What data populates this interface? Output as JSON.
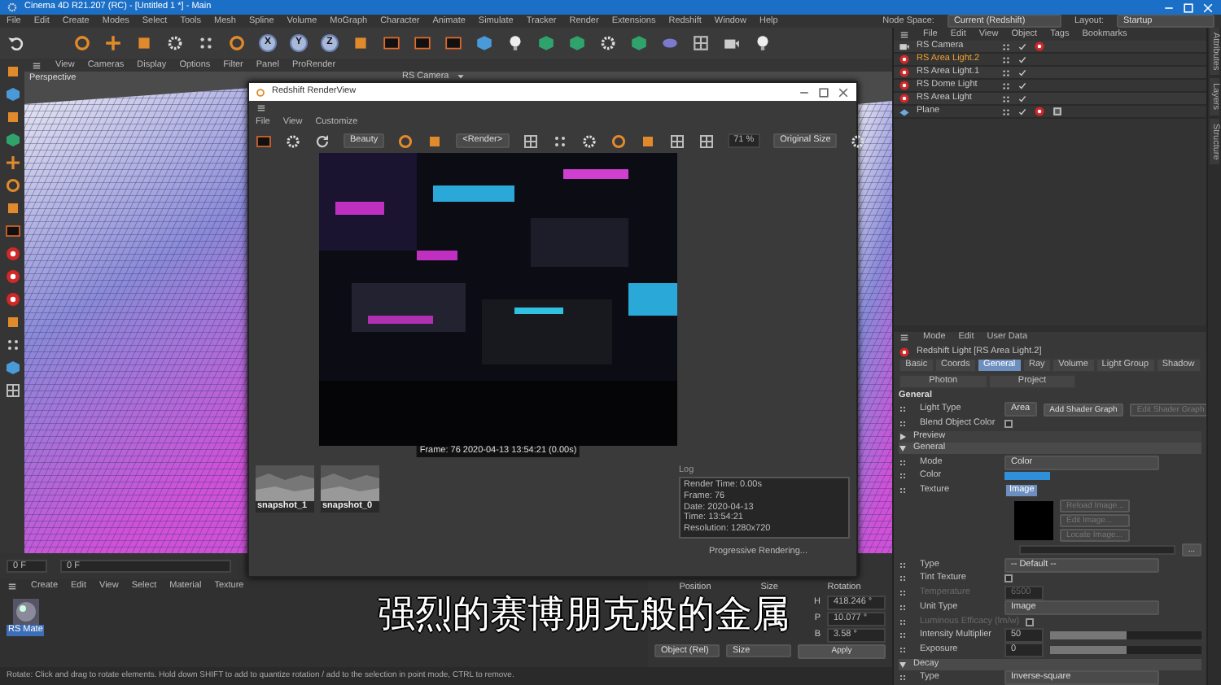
{
  "window": {
    "title": "Cinema 4D R21.207 (RC) - [Untitled 1 *] - Main"
  },
  "menu_bar": [
    "File",
    "Edit",
    "Create",
    "Modes",
    "Select",
    "Tools",
    "Mesh",
    "Spline",
    "Volume",
    "MoGraph",
    "Character",
    "Animate",
    "Simulate",
    "Tracker",
    "Render",
    "Extensions",
    "Redshift",
    "Window",
    "Help"
  ],
  "node_space": {
    "label": "Node Space:",
    "value": "Current (Redshift)"
  },
  "layout": {
    "label": "Layout:",
    "value": "Startup"
  },
  "axis_toggles": [
    {
      "label": "X",
      "on": true
    },
    {
      "label": "Y",
      "on": true
    },
    {
      "label": "Z",
      "on": true
    }
  ],
  "viewport": {
    "menu": [
      "View",
      "Cameras",
      "Display",
      "Options",
      "Filter",
      "Panel",
      "ProRender"
    ],
    "name": "Perspective",
    "camera": "RS Camera"
  },
  "render_view": {
    "title": "Redshift RenderView",
    "menu": [
      "File",
      "View",
      "Customize"
    ],
    "aov": "Beauty",
    "render": "<Render>",
    "zoom": "71 %",
    "size": "Original Size",
    "caption": "Frame: 76  2020-04-13  13:54:21  (0.00s)",
    "snapshots": [
      {
        "label": "snapshot_1"
      },
      {
        "label": "snapshot_0"
      }
    ],
    "log": {
      "title": "Log",
      "lines": [
        "Render Time: 0.00s",
        "Frame: 76",
        "Date: 2020-04-13",
        "Time: 13:54:21",
        "Resolution: 1280x720"
      ]
    },
    "progress": "Progressive Rendering..."
  },
  "object_manager": {
    "menu": [
      "File",
      "Edit",
      "View",
      "Object",
      "Tags",
      "Bookmarks"
    ],
    "objects": [
      {
        "name": "RS Camera",
        "kind": "camera",
        "selected": false
      },
      {
        "name": "RS Area Light.2",
        "kind": "light",
        "selected": true
      },
      {
        "name": "RS Area Light.1",
        "kind": "light",
        "selected": false
      },
      {
        "name": "RS Dome Light",
        "kind": "light",
        "selected": false
      },
      {
        "name": "RS Area Light",
        "kind": "light",
        "selected": false
      },
      {
        "name": "Plane",
        "kind": "plane",
        "selected": false
      }
    ]
  },
  "attributes": {
    "menu": [
      "Mode",
      "Edit",
      "User Data"
    ],
    "title": "Redshift Light [RS Area Light.2]",
    "tabs": [
      {
        "label": "Basic",
        "selected": false
      },
      {
        "label": "Coords",
        "selected": false
      },
      {
        "label": "General",
        "selected": true
      },
      {
        "label": "Ray",
        "selected": false
      },
      {
        "label": "Volume",
        "selected": false
      },
      {
        "label": "Light Group",
        "selected": false
      },
      {
        "label": "Shadow",
        "selected": false
      },
      {
        "label": "Photon",
        "selected": false
      },
      {
        "label": "Project",
        "selected": false
      }
    ],
    "heading": "General",
    "rows": [
      {
        "kind": "dropdown",
        "label": "Light Type",
        "value": "Area",
        "buttons": [
          {
            "label": "Add Shader Graph",
            "disabled": false
          },
          {
            "label": "Edit Shader Graph",
            "disabled": true
          }
        ]
      },
      {
        "kind": "checkbox",
        "label": "Blend Object Color",
        "checked": false
      },
      {
        "kind": "section",
        "label": "Preview",
        "expanded": false
      },
      {
        "kind": "section",
        "label": "General",
        "expanded": true
      },
      {
        "kind": "dropdown",
        "label": "Mode",
        "value": "Color"
      },
      {
        "kind": "color",
        "label": "Color",
        "color": "#2f8fd8"
      },
      {
        "kind": "texture",
        "label": "Texture",
        "tabs": [
          {
            "label": "Image",
            "selected": true
          }
        ],
        "buttons": [
          {
            "label": "Reload Image...",
            "disabled": true
          },
          {
            "label": "Edit Image...",
            "disabled": true
          },
          {
            "label": "Locate Image...",
            "disabled": true
          }
        ],
        "browse": "..."
      },
      {
        "kind": "dropdown",
        "label": "Type",
        "value": "-- Default --"
      },
      {
        "kind": "checkbox",
        "label": "Tint Texture",
        "checked": false
      },
      {
        "kind": "number",
        "label": "Temperature",
        "value": "6500",
        "disabled": true
      },
      {
        "kind": "dropdown",
        "label": "Unit Type",
        "value": "Image"
      },
      {
        "kind": "checkbox",
        "label": "Luminous Efficacy (lm/w)",
        "checked": false,
        "disabled": true
      },
      {
        "kind": "slider",
        "label": "Intensity Multiplier",
        "value": "50",
        "level": 0.5
      },
      {
        "kind": "slider",
        "label": "Exposure",
        "value": "0",
        "level": 0.5
      },
      {
        "kind": "section",
        "label": "Decay",
        "expanded": true
      },
      {
        "kind": "dropdown",
        "label": "Type",
        "value": "Inverse-square"
      }
    ]
  },
  "side_tabs": [
    "Attributes",
    "Layers",
    "Structure"
  ],
  "timeline": {
    "fields": [
      "0 F",
      "0 F"
    ]
  },
  "material_manager": {
    "menu": [
      "Create",
      "Edit",
      "View",
      "Select",
      "Material",
      "Texture"
    ],
    "materials": [
      {
        "name": "RS Mate",
        "selected": true
      }
    ]
  },
  "coordinates": {
    "headers": [
      "Position",
      "Size",
      "Rotation"
    ],
    "rows": [
      {
        "axis": "H",
        "value": "418.246 °"
      },
      {
        "axis": "P",
        "value": "10.077 °"
      },
      {
        "axis": "B",
        "value": "3.58 °"
      }
    ],
    "dropdowns": [
      "Object (Rel)",
      "Size"
    ],
    "apply": "Apply"
  },
  "status_bar": "Rotate: Click and drag to rotate elements. Hold down SHIFT to add to quantize rotation / add to the selection in point mode, CTRL to remove.",
  "subtitle": "强烈的赛博朋克般的金属"
}
